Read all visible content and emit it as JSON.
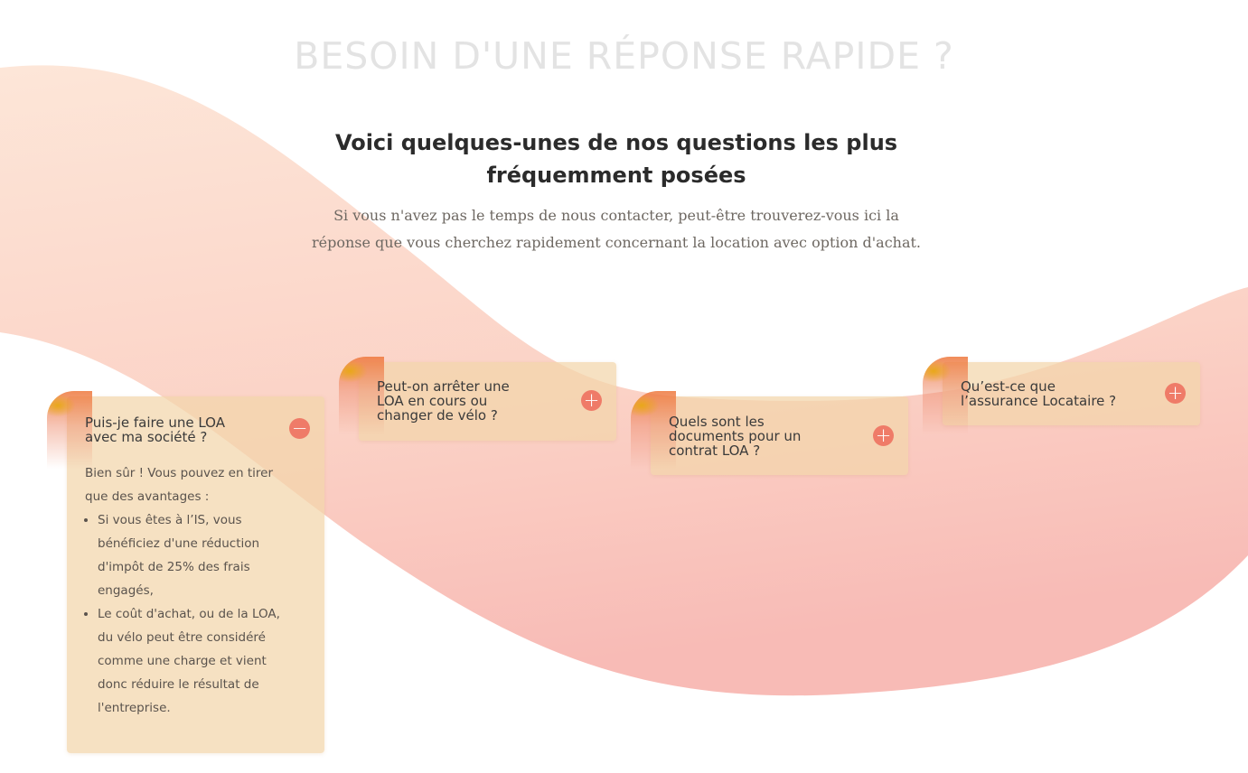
{
  "header": {
    "eyebrow": "BESOIN D'UNE RÉPONSE RAPIDE ?",
    "title": "Voici quelques-unes de nos questions les plus fréquemment posées",
    "subtitle": "Si vous n'avez pas le temps de nous contacter, peut-être trouverez-vous ici la réponse que vous cherchez rapidement concernant la location avec option d'achat."
  },
  "faq": [
    {
      "question": "Puis-je faire une LOA\navec ma société ?",
      "toggle_icon": "minus-circle-icon",
      "toggle_glyph": "−",
      "expanded": true,
      "answer_intro": "Bien sûr ! Vous pouvez en tirer que des avantages :",
      "answer_points": [
        "Si vous êtes à l’IS, vous bénéficiez d'une réduction d'impôt de 25% des frais engagés,",
        "Le coût d'achat, ou de la LOA, du vélo peut être considéré comme une charge et vient donc réduire le résultat de l'entreprise."
      ]
    },
    {
      "question": "Peut-on arrêter une\nLOA en cours ou\nchanger de vélo ?",
      "toggle_icon": "plus-circle-icon",
      "toggle_glyph": "+",
      "expanded": false
    },
    {
      "question": "Quels sont les\ndocuments pour un\ncontrat LOA ?",
      "toggle_icon": "plus-circle-icon",
      "toggle_glyph": "+",
      "expanded": false
    },
    {
      "question": "Qu’est-ce que\nl’assurance Locataire ?",
      "toggle_icon": "plus-circle-icon",
      "toggle_glyph": "+",
      "expanded": false
    }
  ],
  "colors": {
    "accent": "#ef7b68",
    "card_bg": "#f2d6aa",
    "wave_top": "#fde3d3",
    "wave_bottom": "#f9c1bc",
    "eyebrow": "#e3e3e3",
    "heading": "#2b2b2b"
  }
}
